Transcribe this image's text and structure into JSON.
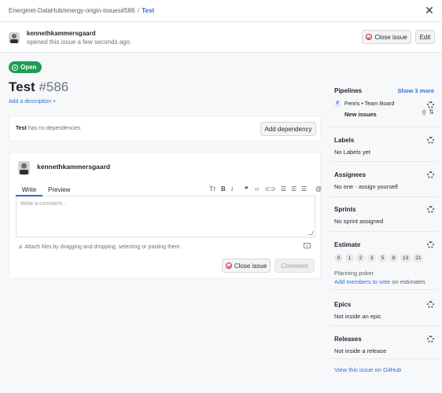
{
  "breadcrumb": {
    "repo": "Energinet-DataHub/energy-origin-issues#586",
    "separator": "/",
    "current": "Test"
  },
  "header": {
    "username": "kennethkammersgaard",
    "opened_text": "opened this issue a few seconds ago",
    "close_label": "Close issue",
    "edit_label": "Edit"
  },
  "issue": {
    "status": "Open",
    "title": "Test",
    "number": "#586",
    "add_description": "Add a description +"
  },
  "dependencies": {
    "subject": "Test",
    "text": "has no dependencies",
    "button": "Add dependency"
  },
  "comment": {
    "username": "kennethkammersgaard",
    "tab_write": "Write",
    "tab_preview": "Preview",
    "placeholder": "Write a comment...",
    "attach_text": "Attach files by dragging and dropping, selecting or pasting them.",
    "close_label": "Close issue",
    "comment_label": "Comment"
  },
  "sidebar": {
    "pipelines": {
      "title": "Pipelines",
      "show_more": "Show 3 more",
      "board": "Fenris • Team Board",
      "board_badge": "F",
      "pipeline": "New issues"
    },
    "labels": {
      "title": "Labels",
      "value": "No Labels yet"
    },
    "assignees": {
      "title": "Assignees",
      "value": "No one - assign yourself"
    },
    "sprints": {
      "title": "Sprints",
      "value": "No sprint assigned"
    },
    "estimate": {
      "title": "Estimate",
      "values": [
        "0",
        "1",
        "2",
        "3",
        "5",
        "8",
        "13",
        "21"
      ],
      "poker": "Planning poker",
      "members_link": "Add members to vote",
      "members_suffix": "on estimates"
    },
    "epics": {
      "title": "Epics",
      "value": "Not inside an epic"
    },
    "releases": {
      "title": "Releases",
      "value": "Not inside a release"
    },
    "github_link": "View this issue on GitHub"
  },
  "colors": {
    "accent": "#2f6fd4",
    "open_green": "#1f9d55",
    "danger": "#d1242f"
  }
}
